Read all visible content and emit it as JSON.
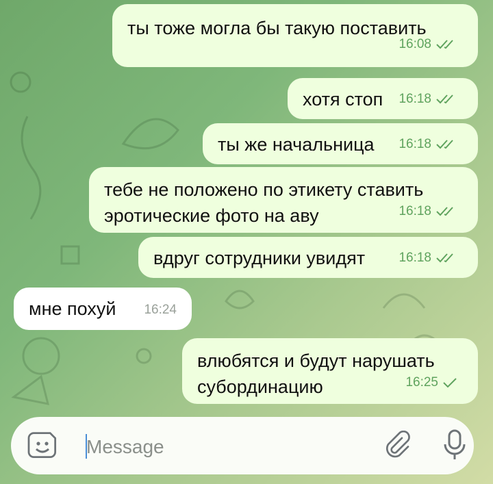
{
  "messages": [
    {
      "text": "ты тоже могла бы такую поставить",
      "time": "16:08",
      "dir": "out",
      "status": "read"
    },
    {
      "text": "хотя стоп",
      "time": "16:18",
      "dir": "out",
      "status": "read"
    },
    {
      "text": "ты же начальница",
      "time": "16:18",
      "dir": "out",
      "status": "read"
    },
    {
      "text": "тебе не положено по этикету ставить\nэротические фото на аву",
      "time": "16:18",
      "dir": "out",
      "status": "read"
    },
    {
      "text": "вдруг сотрудники увидят",
      "time": "16:18",
      "dir": "out",
      "status": "read"
    },
    {
      "text": "мне похуй",
      "time": "16:24",
      "dir": "in",
      "status": ""
    },
    {
      "text": "влюбятся и будут нарушать\nсубординацию",
      "time": "16:25",
      "dir": "out",
      "status": "sent"
    }
  ],
  "composer": {
    "placeholder": "Message",
    "value": "",
    "sticker_icon": "sticker-icon",
    "attach_icon": "paperclip-icon",
    "mic_icon": "microphone-icon"
  },
  "colors": {
    "outgoing_bubble": "#efffde",
    "incoming_bubble": "#ffffff",
    "check_color": "#5fa35e"
  }
}
